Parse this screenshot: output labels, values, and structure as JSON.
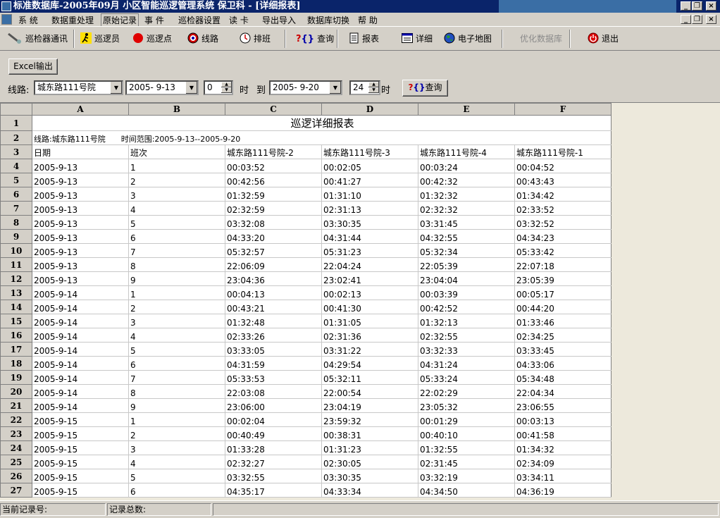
{
  "window": {
    "title": "标准数据库-2005年09月  小区智能巡逻管理系统   保卫科 - [详细报表]"
  },
  "menu": [
    "系  统",
    "数据重处理",
    "原始记录",
    "事  件",
    "巡检器设置",
    "读  卡",
    "导出导入",
    "数据库切换",
    "帮  助"
  ],
  "toolbar": {
    "comm": "巡检器通讯",
    "patroller": "巡逻员",
    "point": "巡逻点",
    "route": "线路",
    "schedule": "排班",
    "query": "查询",
    "report": "报表",
    "detail": "详细",
    "map": "电子地图",
    "optimize": "优化数据库",
    "exit": "退出"
  },
  "icons": {
    "comm": "flashlight-icon",
    "patroller": "runner-icon",
    "point": "red-dot-icon",
    "route": "route-icon",
    "schedule": "clock-icon",
    "query": "query-icon",
    "report": "report-icon",
    "detail": "detail-icon",
    "map": "globe-icon",
    "exit": "power-icon"
  },
  "colors": {
    "title_bar": "#0a246a",
    "point_dot": "#e00000"
  },
  "filter": {
    "excel_button": "Excel输出",
    "route_label": "线路:",
    "route_value": "城东路111号院",
    "start_date": "2005- 9-13",
    "start_hour": "0",
    "hour_label": "时",
    "to_label": "到",
    "end_date": "2005- 9-20",
    "end_hour": "24",
    "end_hour_label": "时",
    "query_button": "查询"
  },
  "sheet": {
    "columns": [
      "A",
      "B",
      "C",
      "D",
      "E",
      "F"
    ],
    "title": "巡逻详细报表",
    "info_route": "线路:城东路111号院",
    "info_range": "时间范围:2005-9-13--2005-9-20",
    "header": [
      "日期",
      "班次",
      "城东路111号院-2",
      "城东路111号院-3",
      "城东路111号院-4",
      "城东路111号院-1"
    ],
    "rows": [
      [
        "2005-9-13",
        "1",
        "00:03:52",
        "00:02:05",
        "00:03:24",
        "00:04:52"
      ],
      [
        "2005-9-13",
        "2",
        "00:42:56",
        "00:41:27",
        "00:42:32",
        "00:43:43"
      ],
      [
        "2005-9-13",
        "3",
        "01:32:59",
        "01:31:10",
        "01:32:32",
        "01:34:42"
      ],
      [
        "2005-9-13",
        "4",
        "02:32:59",
        "02:31:13",
        "02:32:32",
        "02:33:52"
      ],
      [
        "2005-9-13",
        "5",
        "03:32:08",
        "03:30:35",
        "03:31:45",
        "03:32:52"
      ],
      [
        "2005-9-13",
        "6",
        "04:33:20",
        "04:31:44",
        "04:32:55",
        "04:34:23"
      ],
      [
        "2005-9-13",
        "7",
        "05:32:57",
        "05:31:23",
        "05:32:34",
        "05:33:42"
      ],
      [
        "2005-9-13",
        "8",
        "22:06:09",
        "22:04:24",
        "22:05:39",
        "22:07:18"
      ],
      [
        "2005-9-13",
        "9",
        "23:04:36",
        "23:02:41",
        "23:04:04",
        "23:05:39"
      ],
      [
        "2005-9-14",
        "1",
        "00:04:13",
        "00:02:13",
        "00:03:39",
        "00:05:17"
      ],
      [
        "2005-9-14",
        "2",
        "00:43:21",
        "00:41:30",
        "00:42:52",
        "00:44:20"
      ],
      [
        "2005-9-14",
        "3",
        "01:32:48",
        "01:31:05",
        "01:32:13",
        "01:33:46"
      ],
      [
        "2005-9-14",
        "4",
        "02:33:26",
        "02:31:36",
        "02:32:55",
        "02:34:25"
      ],
      [
        "2005-9-14",
        "5",
        "03:33:05",
        "03:31:22",
        "03:32:33",
        "03:33:45"
      ],
      [
        "2005-9-14",
        "6",
        "04:31:59",
        "04:29:54",
        "04:31:24",
        "04:33:06"
      ],
      [
        "2005-9-14",
        "7",
        "05:33:53",
        "05:32:11",
        "05:33:24",
        "05:34:48"
      ],
      [
        "2005-9-14",
        "8",
        "22:03:08",
        "22:00:54",
        "22:02:29",
        "22:04:34"
      ],
      [
        "2005-9-14",
        "9",
        "23:06:00",
        "23:04:19",
        "23:05:32",
        "23:06:55"
      ],
      [
        "2005-9-15",
        "1",
        "00:02:04",
        "23:59:32",
        "00:01:29",
        "00:03:13"
      ],
      [
        "2005-9-15",
        "2",
        "00:40:49",
        "00:38:31",
        "00:40:10",
        "00:41:58"
      ],
      [
        "2005-9-15",
        "3",
        "01:33:28",
        "01:31:23",
        "01:32:55",
        "01:34:32"
      ],
      [
        "2005-9-15",
        "4",
        "02:32:27",
        "02:30:05",
        "02:31:45",
        "02:34:09"
      ],
      [
        "2005-9-15",
        "5",
        "03:32:55",
        "03:30:35",
        "03:32:19",
        "03:34:11"
      ],
      [
        "2005-9-15",
        "6",
        "04:35:17",
        "04:33:34",
        "04:34:50",
        "04:36:19"
      ]
    ]
  },
  "status": {
    "current_record": "当前记录号:",
    "total_records": "记录总数:"
  }
}
